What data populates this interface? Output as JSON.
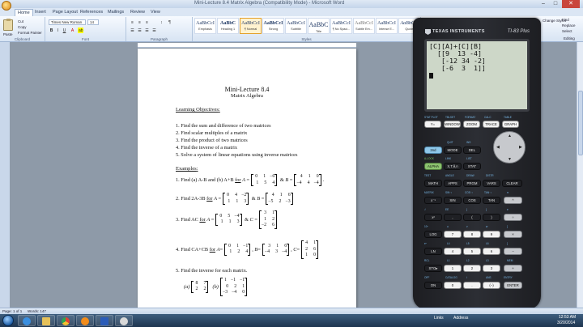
{
  "window": {
    "title": "Mini-Lecture 8.4 Matrix Algebra (Compatibility Mode) - Microsoft Word",
    "min": "–",
    "max": "□",
    "close": "✕"
  },
  "ribbon_tabs": [
    "Home",
    "Insert",
    "Page Layout",
    "References",
    "Mailings",
    "Review",
    "View"
  ],
  "ribbon": {
    "clipboard": {
      "label": "Clipboard",
      "paste": "Paste",
      "cut": "Cut",
      "copy": "Copy",
      "format_painter": "Format Painter"
    },
    "font": {
      "label": "Font",
      "name": "Times New Roman",
      "size": "14"
    },
    "paragraph": {
      "label": "Paragraph"
    },
    "styles": {
      "label": "Styles",
      "tiles": [
        {
          "sample": "AaBbCcI",
          "name": "Emphasis"
        },
        {
          "sample": "AaBbC",
          "name": "Heading 1"
        },
        {
          "sample": "AaBbCcI",
          "name": "¶ Normal",
          "selected": true
        },
        {
          "sample": "AaBbCcI",
          "name": "Strong"
        },
        {
          "sample": "AaBbCcI",
          "name": "Subtitle"
        },
        {
          "sample": "AaBbC",
          "name": "Title"
        },
        {
          "sample": "AaBbCcI",
          "name": "¶ No Spaci..."
        },
        {
          "sample": "AaBbCcI",
          "name": "Subtle Em..."
        },
        {
          "sample": "AaBbCcI",
          "name": "Intense E..."
        },
        {
          "sample": "AaBbCcI",
          "name": "Quote"
        }
      ],
      "change_styles": "Change Styles"
    },
    "editing": {
      "label": "Editing",
      "find": "Find",
      "replace": "Replace",
      "select": "Select"
    }
  },
  "document": {
    "title": "Mini-Lecture 8.4",
    "subtitle": "Matrix Algebra",
    "objectives_heading": "Learning Objectives",
    "objectives": [
      "1.  Find the sum and difference of two matrices",
      "2.  Find scalar multiples of a matrix",
      "3.  Find the product of two matrices",
      "4.  Find the inverse of a matrix",
      "5.  Solve a system of linear equations using inverse matrices"
    ],
    "examples_heading": "Examples",
    "problems": {
      "p1": {
        "text": "1.  Find (a) A-B and (b) A+B",
        "for": "for",
        "A": [
          [
            "0",
            "1",
            "−6"
          ],
          [
            "1",
            "5",
            "4"
          ]
        ],
        "B": [
          [
            "4",
            "1",
            "0"
          ],
          [
            "−4",
            "4",
            "−4"
          ]
        ]
      },
      "p2": {
        "text": "2.  Find 2A-3B",
        "for": "for",
        "A": [
          [
            "0",
            "4",
            "−2"
          ],
          [
            "1",
            "1",
            "3"
          ]
        ],
        "B": [
          [
            "4",
            "1",
            "6"
          ],
          [
            "−5",
            "2",
            "−3"
          ]
        ]
      },
      "p3": {
        "text": "3.  Find AC",
        "for": "for",
        "A": [
          [
            "0",
            "5",
            "−4"
          ],
          [
            "1",
            "1",
            "3"
          ]
        ],
        "C": [
          [
            "3",
            "1"
          ],
          [
            "1",
            "2"
          ],
          [
            "−2",
            "6"
          ]
        ]
      },
      "p4": {
        "text": "4.  Find CA+CB",
        "for": "for",
        "A": [
          [
            "0",
            "1",
            "−1"
          ],
          [
            "1",
            "2",
            "4"
          ]
        ],
        "B": [
          [
            "3",
            "1",
            "6"
          ],
          [
            "−4",
            "3",
            "−4"
          ]
        ],
        "C": [
          [
            "4",
            "1"
          ],
          [
            "2",
            "6"
          ],
          [
            "1",
            "0"
          ]
        ]
      },
      "p5": {
        "text": "5.  Find the inverse for each matrix.",
        "a_label": "(a)",
        "a": [
          [
            "8",
            "7"
          ],
          [
            "2",
            "2"
          ]
        ],
        "b_label": "(b)",
        "b": [
          [
            "1",
            "−1",
            "−1"
          ],
          [
            "0",
            "2",
            "1"
          ],
          [
            "−3",
            "−4",
            "0"
          ]
        ]
      }
    }
  },
  "calculator": {
    "brand": "TEXAS INSTRUMENTS",
    "model": "TI-83 Plus",
    "screen_lines": [
      "[C][A]+[C][B]",
      "  [[9  13 -4]",
      "   [-12 34 -2]",
      "   [-6  3  1]]"
    ],
    "keys": {
      "row_top": [
        "Y=",
        "WINDOW",
        "ZOOM",
        "TRACE",
        "GRAPH"
      ],
      "row2": [
        "2nd",
        "MODE",
        "DEL"
      ],
      "row3": [
        "ALPHA",
        "X,T,θ,n",
        "STAT"
      ],
      "row4": [
        "MATH",
        "APPS",
        "PRGM",
        "VARS",
        "CLEAR"
      ],
      "row5": [
        "x⁻¹",
        "SIN",
        "COS",
        "TAN",
        "^"
      ],
      "row6": [
        "x²",
        ",",
        "(",
        ")",
        "÷"
      ],
      "row7": [
        "LOG",
        "7",
        "8",
        "9",
        "×"
      ],
      "row8": [
        "LN",
        "4",
        "5",
        "6",
        "−"
      ],
      "row9": [
        "STO▸",
        "1",
        "2",
        "3",
        "+"
      ],
      "row10": [
        "ON",
        "0",
        ".",
        "(−)",
        "ENTER"
      ]
    },
    "fn_labels": [
      "STAT PLOT",
      "TBLSET",
      "FORMAT",
      "CALC",
      "TABLE",
      "QUIT",
      "INS",
      "A-LOCK",
      "LINK",
      "LIST",
      "TEST",
      "ANGLE",
      "DRAW",
      "DISTR",
      "MATRIX",
      "SIN⁻¹",
      "COS⁻¹",
      "TAN⁻¹",
      "π",
      "√",
      "EE",
      "{",
      "}",
      "e",
      "10ˣ",
      "u",
      "v",
      "w",
      "[",
      "eˣ",
      "L4",
      "L5",
      "L6",
      "]",
      "RCL",
      "L1",
      "L2",
      "L3",
      "MEM",
      "OFF",
      "CATALOG",
      "i",
      "ANS",
      "?",
      "ENTRY",
      "SOLVE"
    ]
  },
  "status": {
    "page": "Page: 1 of 1",
    "words": "Words: 147",
    "links": "Links",
    "address": "Address"
  },
  "taskbar": {
    "time": "12:53 AM",
    "date": "3/20/2014"
  }
}
